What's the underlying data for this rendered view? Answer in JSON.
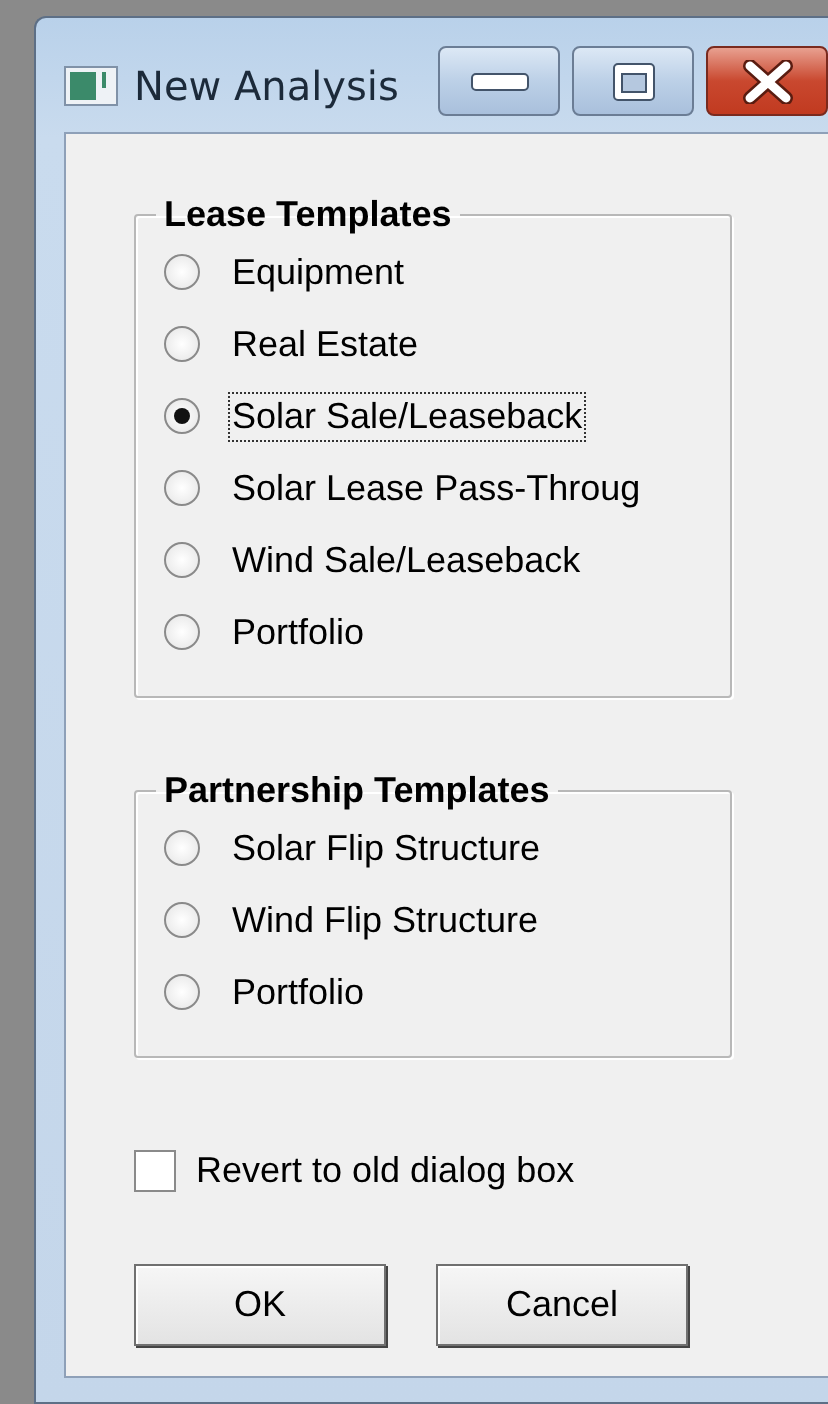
{
  "window": {
    "title": "New Analysis"
  },
  "groups": [
    {
      "title": "Lease Templates",
      "options": [
        {
          "label": "Equipment",
          "selected": false
        },
        {
          "label": "Real Estate",
          "selected": false
        },
        {
          "label": "Solar Sale/Leaseback",
          "selected": true
        },
        {
          "label": "Solar Lease Pass-Throug",
          "selected": false
        },
        {
          "label": "Wind Sale/Leaseback",
          "selected": false
        },
        {
          "label": "Portfolio",
          "selected": false
        }
      ]
    },
    {
      "title": "Partnership Templates",
      "options": [
        {
          "label": "Solar Flip Structure",
          "selected": false
        },
        {
          "label": "Wind Flip Structure",
          "selected": false
        },
        {
          "label": "Portfolio",
          "selected": false
        }
      ]
    }
  ],
  "revert": {
    "label": "Revert to old dialog box",
    "checked": false
  },
  "buttons": [
    {
      "label": "OK"
    },
    {
      "label": "Cancel"
    }
  ]
}
